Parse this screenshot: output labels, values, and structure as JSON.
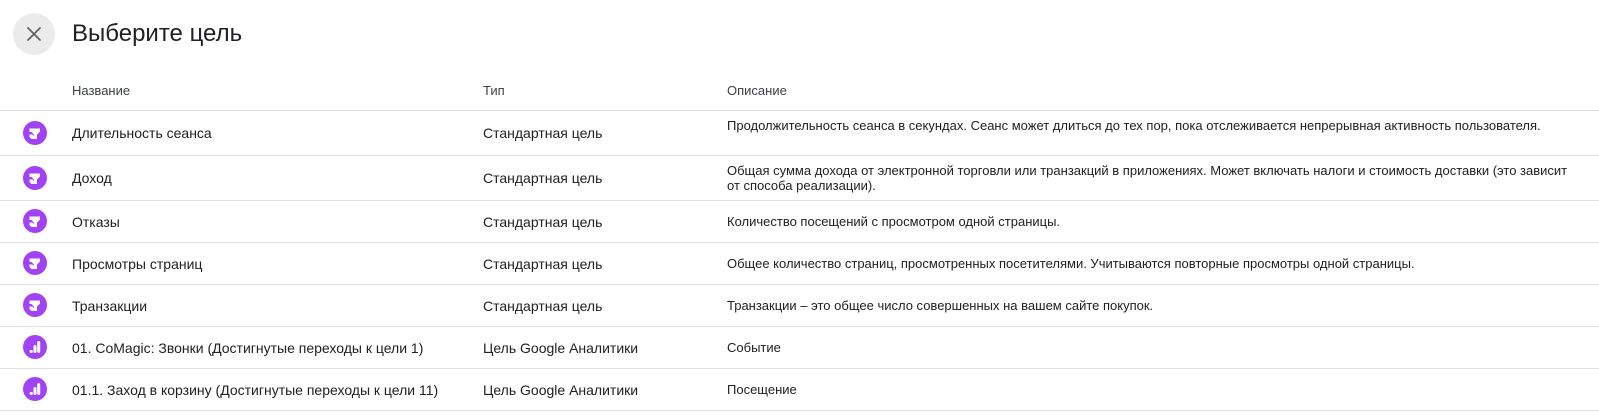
{
  "dialog": {
    "title": "Выберите цель",
    "close_icon": "close-icon"
  },
  "table": {
    "headers": {
      "name": "Название",
      "type": "Тип",
      "description": "Описание"
    },
    "rows": [
      {
        "icon": "standard-goal-icon",
        "name": "Длительность сеанса",
        "type": "Стандартная цель",
        "description": "Продолжительность сеанса в секундах. Сеанс может длиться до тех пор, пока отслеживается непрерывная активность пользователя."
      },
      {
        "icon": "standard-goal-icon",
        "name": "Доход",
        "type": "Стандартная цель",
        "description": "Общая сумма дохода от электронной торговли или транзакций в приложениях. Может включать налоги и стоимость доставки (это зависит от способа реализации)."
      },
      {
        "icon": "standard-goal-icon",
        "name": "Отказы",
        "type": "Стандартная цель",
        "description": "Количество посещений с просмотром одной страницы."
      },
      {
        "icon": "standard-goal-icon",
        "name": "Просмотры страниц",
        "type": "Стандартная цель",
        "description": "Общее количество страниц, просмотренных посетителями. Учитываются повторные просмотры одной страницы."
      },
      {
        "icon": "standard-goal-icon",
        "name": "Транзакции",
        "type": "Стандартная цель",
        "description": "Транзакции – это общее число совершенных на вашем сайте покупок."
      },
      {
        "icon": "google-analytics-icon",
        "name": "01. CoMagic: Звонки (Достигнутые переходы к цели 1)",
        "type": "Цель Google Аналитики",
        "description": "Событие"
      },
      {
        "icon": "google-analytics-icon",
        "name": "01.1. Заход в корзину (Достигнутые переходы к цели 11)",
        "type": "Цель Google Аналитики",
        "description": "Посещение"
      }
    ]
  },
  "colors": {
    "icon_purple": "#a142f4",
    "divider": "#e0e0e0",
    "close_bg": "#ebebeb"
  }
}
